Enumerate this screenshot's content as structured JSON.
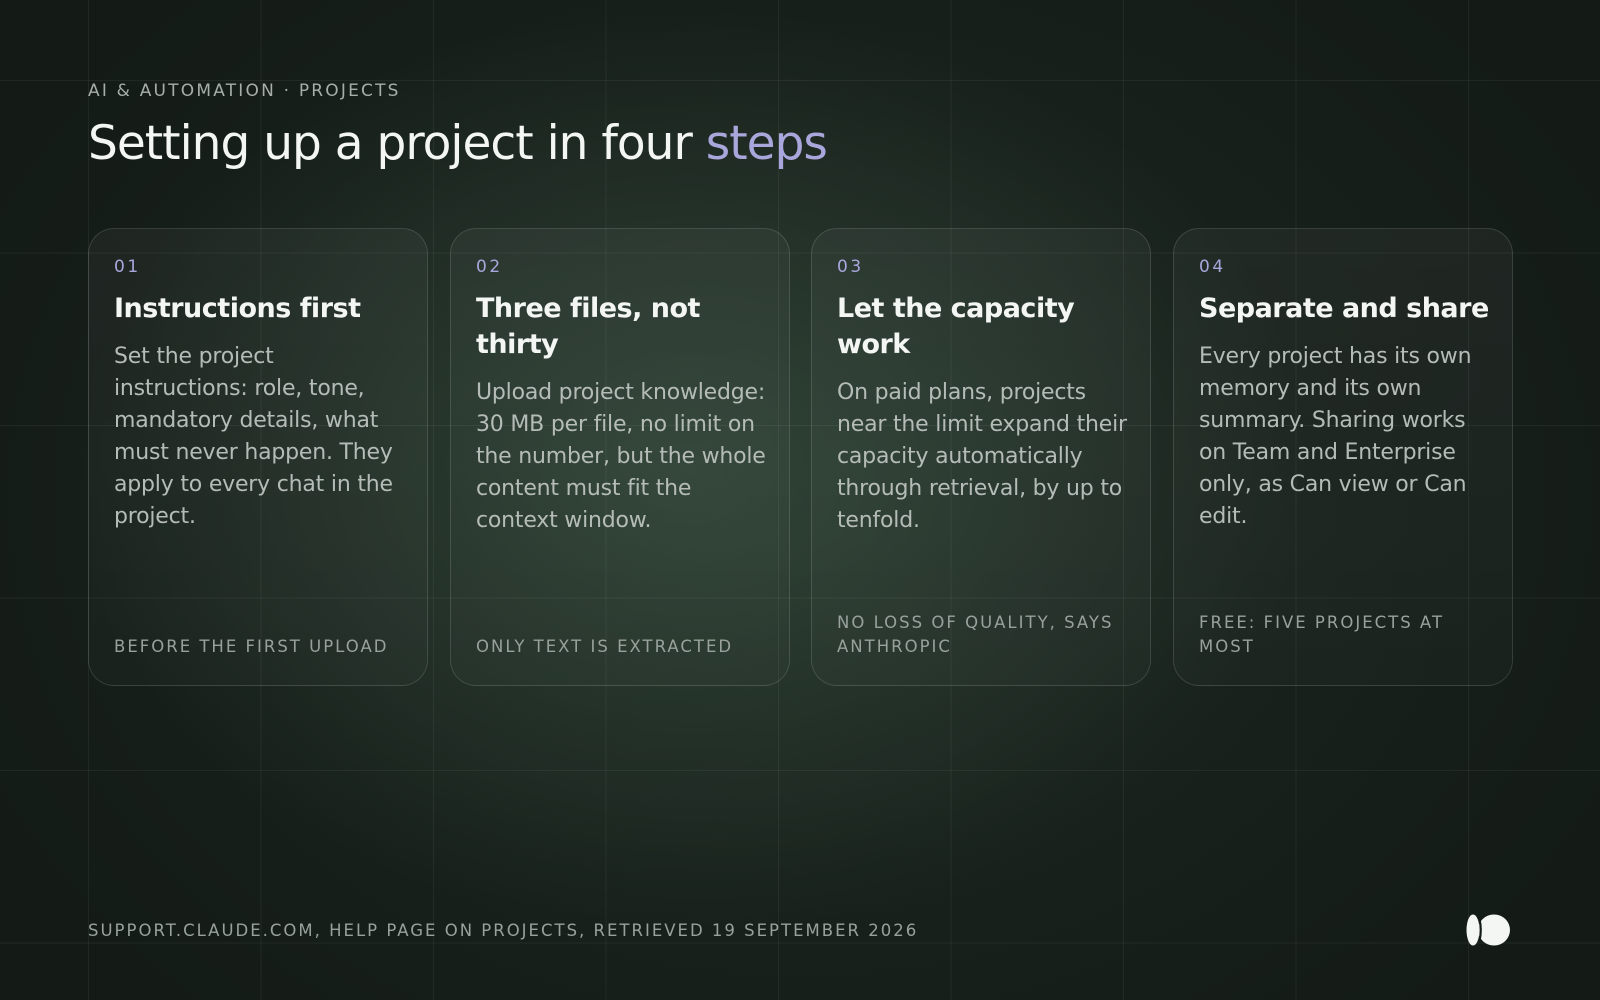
{
  "eyebrow": "AI & AUTOMATION · PROJECTS",
  "title": {
    "main": "Setting up a project in four ",
    "accent": "steps"
  },
  "cards": [
    {
      "number": "01",
      "title": "Instructions first",
      "body": "Set the project instructions: role, tone, mandatory details, what must never happen. They apply to every chat in the project.",
      "footer": "BEFORE THE FIRST UPLOAD"
    },
    {
      "number": "02",
      "title": "Three files, not thirty",
      "body": "Upload project knowledge: 30 MB per file, no limit on the number, but the whole content must fit the context window.",
      "footer": "ONLY TEXT IS EXTRACTED"
    },
    {
      "number": "03",
      "title": "Let the capacity work",
      "body": "On paid plans, projects near the limit expand their capacity automatically through retrieval, by up to tenfold.",
      "footer": "NO LOSS OF QUALITY, SAYS ANTHROPIC"
    },
    {
      "number": "04",
      "title": "Separate and share",
      "body": "Every project has its own memory and its own summary. Sharing works on Team and Enterprise only, as Can view or Can edit.",
      "footer": "FREE: FIVE PROJECTS AT MOST"
    }
  ],
  "footer": "SUPPORT.CLAUDE.COM, HELP PAGE ON PROJECTS, RETRIEVED 19 SEPTEMBER 2026",
  "colors": {
    "background": "#141b17",
    "accent": "#a9a6dc",
    "text": "#f4f6f3",
    "muted": "#99a19c"
  },
  "icons": {
    "logo": "brand-logo-icon"
  }
}
